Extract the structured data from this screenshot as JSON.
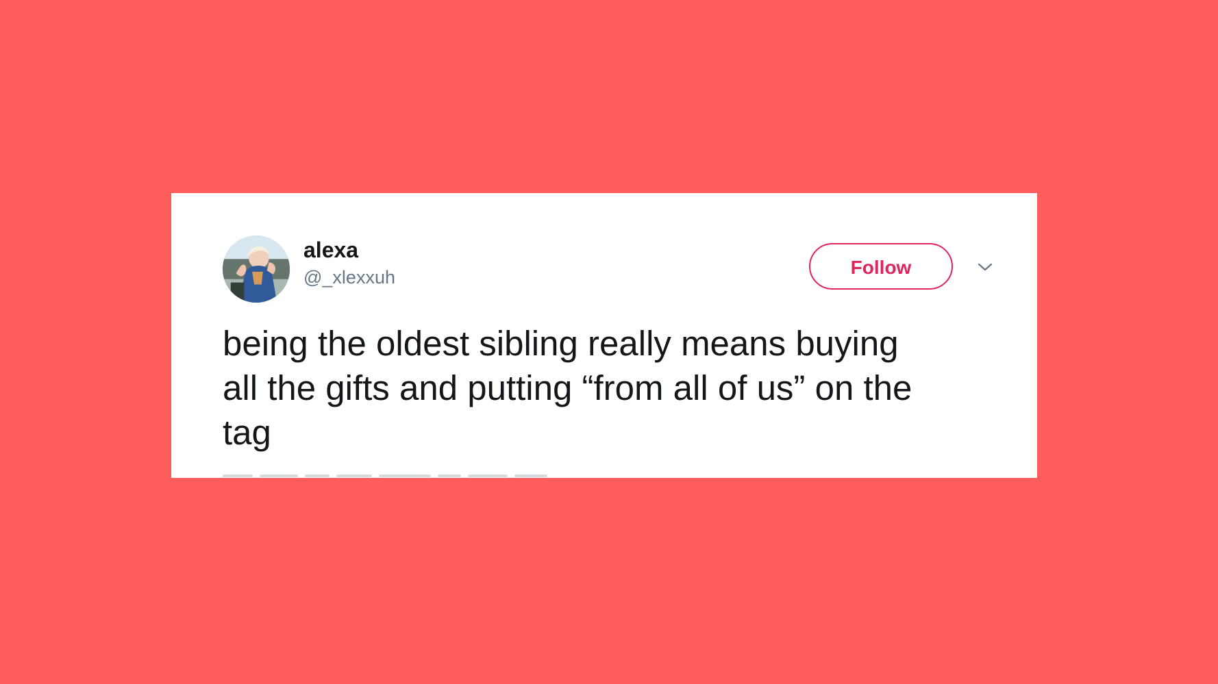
{
  "theme": {
    "background": "#ff5c5c",
    "card_background": "#ffffff",
    "accent": "#e0245e",
    "text_primary": "#14171a",
    "text_secondary": "#657786"
  },
  "tweet": {
    "author": {
      "display_name": "alexa",
      "handle": "@_xlexxuh",
      "avatar": "profile-photo"
    },
    "follow_label": "Follow",
    "menu_icon": "chevron-down-icon",
    "text_lines": [
      "being the oldest sibling really means buying",
      "all the gifts and putting “from all of us” on the",
      "tag"
    ]
  }
}
